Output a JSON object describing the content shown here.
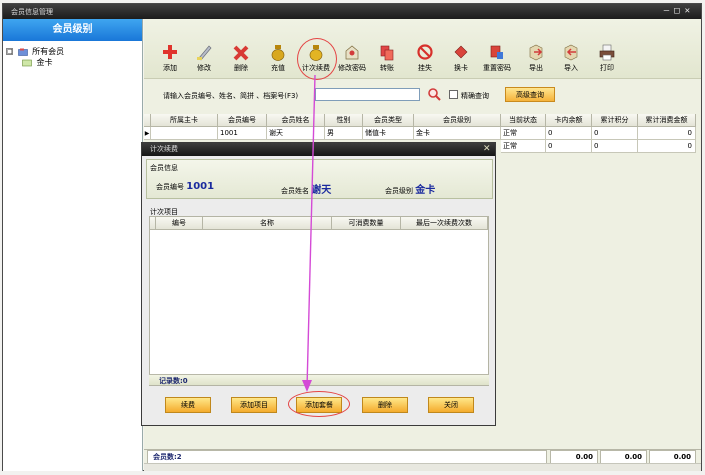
{
  "window": {
    "title": "会员信息管理",
    "controls": [
      "–",
      "□",
      "✕"
    ]
  },
  "left_panel": {
    "header": "会员级别",
    "tree": [
      {
        "label": "所有会员",
        "toggle": "□",
        "icon": "folder-icon"
      },
      {
        "label": "金卡",
        "icon": "card-icon"
      }
    ]
  },
  "toolbar": [
    {
      "id": "add",
      "label": "添加",
      "icon": "plus-icon"
    },
    {
      "id": "edit",
      "label": "修改",
      "icon": "pencil-icon"
    },
    {
      "id": "delete",
      "label": "删除",
      "icon": "x-icon"
    },
    {
      "id": "recharge",
      "label": "充值",
      "icon": "money-bag-icon"
    },
    {
      "id": "count-renew",
      "label": "计次续费",
      "icon": "money-bag-icon"
    },
    {
      "id": "change-pwd",
      "label": "修改密码",
      "icon": "key-box-icon"
    },
    {
      "id": "freeze",
      "label": "转账",
      "icon": "transfer-icon"
    },
    {
      "id": "report-loss",
      "label": "挂失",
      "icon": "no-entry-icon"
    },
    {
      "id": "change-card",
      "label": "换卡",
      "icon": "card-swap-icon"
    },
    {
      "id": "reset-pwd",
      "label": "重置密码",
      "icon": "reset-icon"
    },
    {
      "id": "export",
      "label": "导出",
      "icon": "export-icon"
    },
    {
      "id": "import",
      "label": "导入",
      "icon": "import-icon"
    },
    {
      "id": "print",
      "label": "打印",
      "icon": "printer-icon"
    }
  ],
  "search": {
    "label": "请输入会员编号、姓名、简拼 、档案号(F3)",
    "value": "",
    "exact_label": "精确查询",
    "advanced_label": "高级查询"
  },
  "grid": {
    "columns": [
      "",
      "所属主卡",
      "会员编号",
      "会员姓名",
      "性别",
      "会员类型",
      "会员级别",
      "当前状态",
      "卡内余额",
      "累计积分",
      "累计消费金额"
    ],
    "rows": [
      [
        "▶",
        "",
        "1001",
        "谢天",
        "男",
        "储值卡",
        "金卡",
        "正常",
        "0",
        "0",
        "0"
      ],
      [
        "",
        "",
        "",
        "",
        "",
        "",
        "",
        "正常",
        "0",
        "0",
        "0"
      ]
    ]
  },
  "status": {
    "count": "会员数:2",
    "sums": [
      "0.00",
      "0.00",
      "0.00"
    ]
  },
  "dialog": {
    "title": "计次续费",
    "info_title": "会员信息",
    "member_no_label": "会员编号",
    "member_no": "1001",
    "member_name_label": "会员姓名",
    "member_name": "谢天",
    "member_level_label": "会员级别",
    "member_level": "金卡",
    "items_title": "计次项目",
    "columns": [
      "",
      "编号",
      "名称",
      "可消费数量",
      "最后一次续费次数"
    ],
    "record_count": "记录数:0",
    "buttons": [
      "续费",
      "添加项目",
      "添加套餐",
      "删除",
      "关闭"
    ]
  },
  "colors": {
    "highlight": "#e44545",
    "arrow": "#d44ad6",
    "header_blue": "#1977d8"
  }
}
